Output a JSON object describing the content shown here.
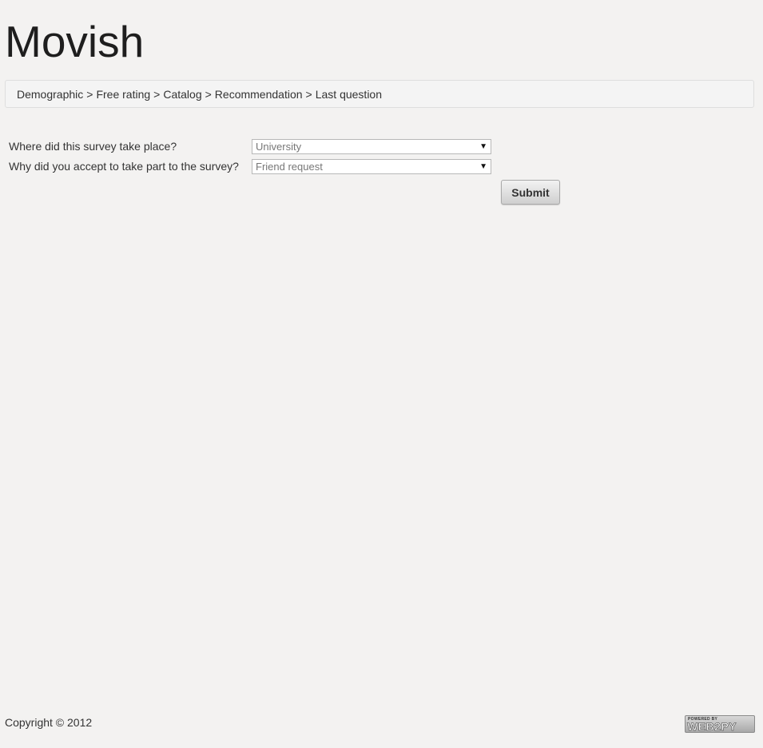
{
  "header": {
    "title": "Movish"
  },
  "breadcrumb": {
    "items": [
      "Demographic",
      "Free rating",
      "Catalog",
      "Recommendation",
      "Last question"
    ],
    "separator": ">"
  },
  "form": {
    "fields": [
      {
        "label": "Where did this survey take place?",
        "selected": "University"
      },
      {
        "label": "Why did you accept to take part to the survey?",
        "selected": "Friend request"
      }
    ],
    "submit_label": "Submit"
  },
  "footer": {
    "copyright": "Copyright © 2012",
    "badge": {
      "top": "POWERED BY",
      "main": "WEB2PY"
    }
  }
}
